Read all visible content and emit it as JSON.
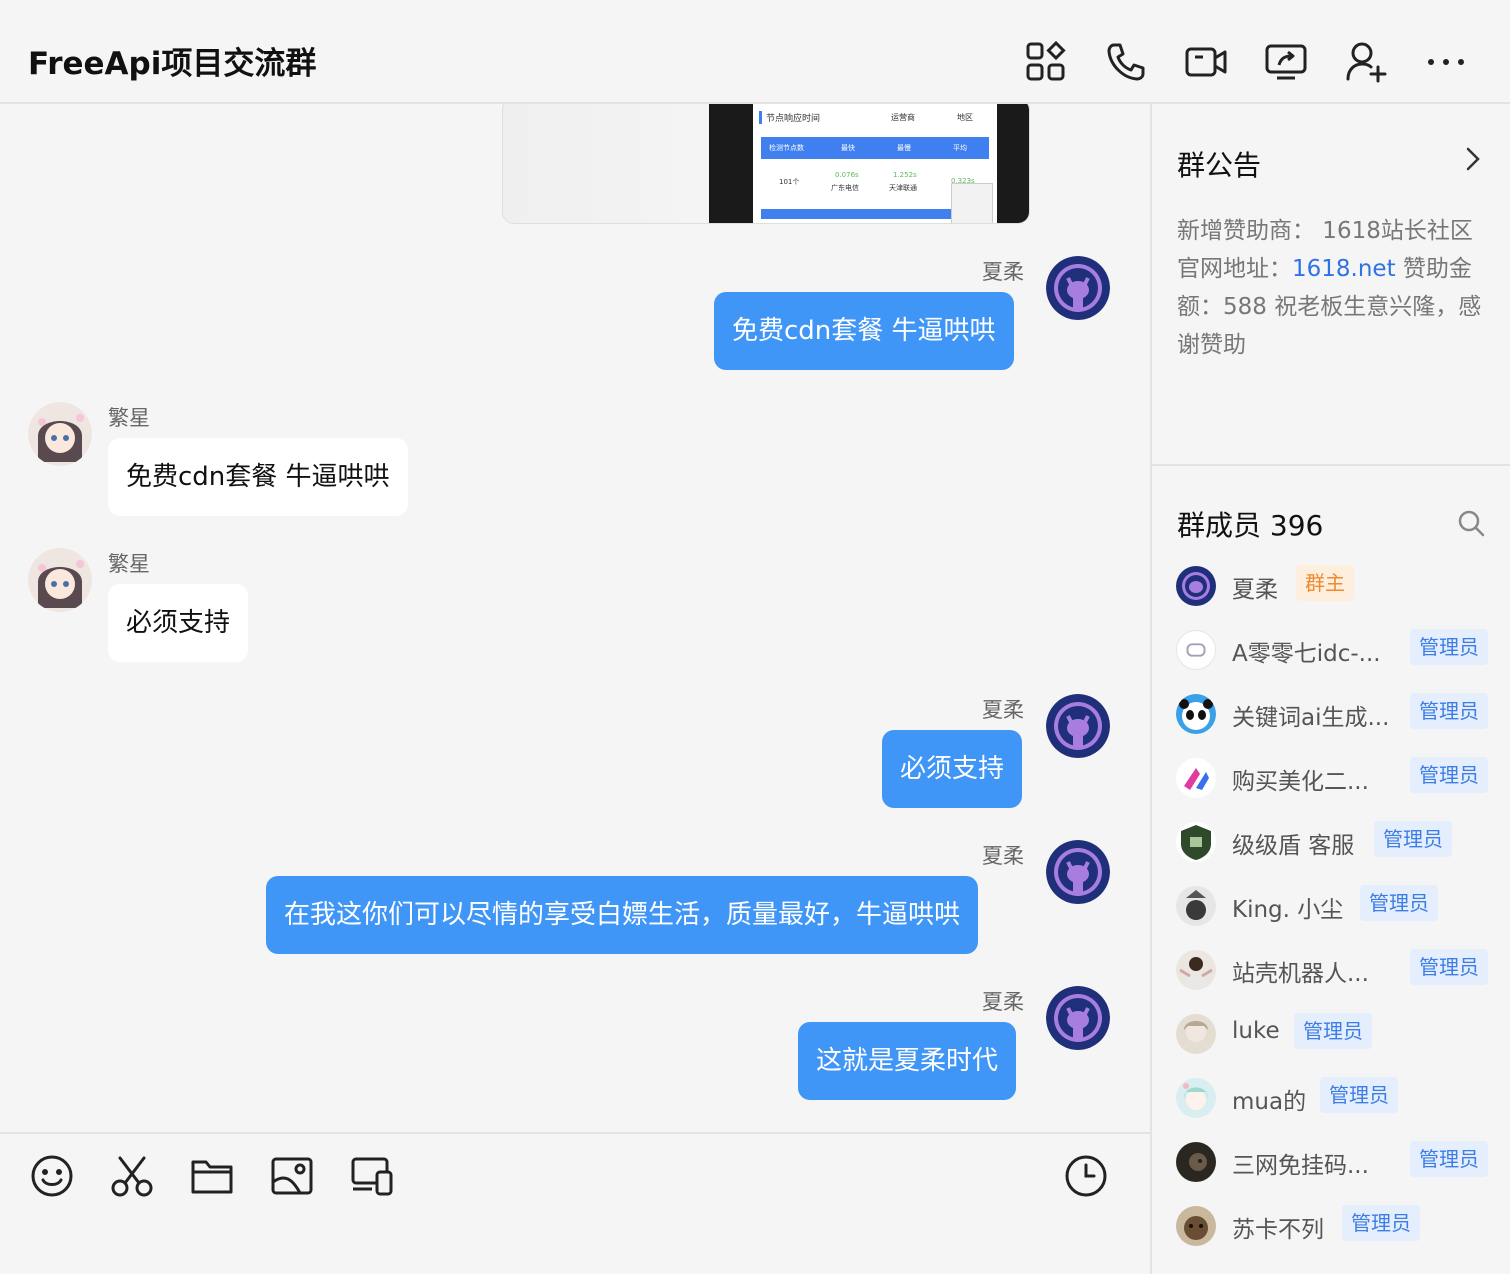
{
  "header": {
    "title": "FreeApi项目交流群",
    "icons": [
      "apps-icon",
      "phone-icon",
      "video-icon",
      "screen-share-icon",
      "add-member-icon",
      "more-icon"
    ]
  },
  "chat": {
    "screenshot_card": {
      "title": "节点响应时间",
      "select_isp": "运营商",
      "select_region": "地区",
      "headers": [
        "检测节点数",
        "最快",
        "最慢",
        "平均"
      ],
      "row": {
        "nodes": "101个",
        "fastest": "0.076s",
        "fastest_loc": "广东电信",
        "slowest": "1.252s",
        "slowest_loc": "天津联通",
        "avg": "0.323s"
      }
    },
    "messages": [
      {
        "sender": "夏柔",
        "text": "免费cdn套餐 牛逼哄哄",
        "self": true
      },
      {
        "sender": "繁星",
        "text": "免费cdn套餐 牛逼哄哄",
        "self": false
      },
      {
        "sender": "繁星",
        "text": "必须支持",
        "self": false
      },
      {
        "sender": "夏柔",
        "text": "必须支持",
        "self": true
      },
      {
        "sender": "夏柔",
        "text": "在我这你们可以尽情的享受白嫖生活，质量最好，牛逼哄哄",
        "self": true
      },
      {
        "sender": "夏柔",
        "text": "这就是夏柔时代",
        "self": true
      }
    ]
  },
  "toolbar": {
    "icons": [
      "emoji-icon",
      "scissors-icon",
      "folder-icon",
      "image-icon",
      "devices-icon",
      "history-icon"
    ]
  },
  "sidebar": {
    "announcement_title": "群公告",
    "announcement_pre": "新增赞助商： 1618站长社区 官网地址：",
    "announcement_link": "1618.net",
    "announcement_post": " 赞助金额：588 祝老板生意兴隆，感谢赞助",
    "members_title": "群成员 396",
    "members": [
      {
        "name": "夏柔",
        "role": "群主",
        "avatar_color": "#1f2f7a"
      },
      {
        "name": "A零零七idc-...",
        "role": "管理员",
        "avatar_color": "#ffffff"
      },
      {
        "name": "关键词ai生成...",
        "role": "管理员",
        "avatar_color": "#3aa0e8"
      },
      {
        "name": "购买美化二...",
        "role": "管理员",
        "avatar_color": "#ffffff"
      },
      {
        "name": "级级盾 客服",
        "role": "管理员",
        "avatar_color": "#2f4a2a"
      },
      {
        "name": "King. 小尘",
        "role": "管理员",
        "avatar_color": "#d9d9d9"
      },
      {
        "name": "站壳机器人...",
        "role": "管理员",
        "avatar_color": "#e8d8c8"
      },
      {
        "name": "luke",
        "role": "管理员",
        "avatar_color": "#d8d0c4"
      },
      {
        "name": "mua的",
        "role": "管理员",
        "avatar_color": "#cfe3ea"
      },
      {
        "name": "三网免挂码...",
        "role": "管理员",
        "avatar_color": "#2a2620"
      },
      {
        "name": "苏卡不列",
        "role": "管理员",
        "avatar_color": "#6a4e34"
      }
    ]
  }
}
